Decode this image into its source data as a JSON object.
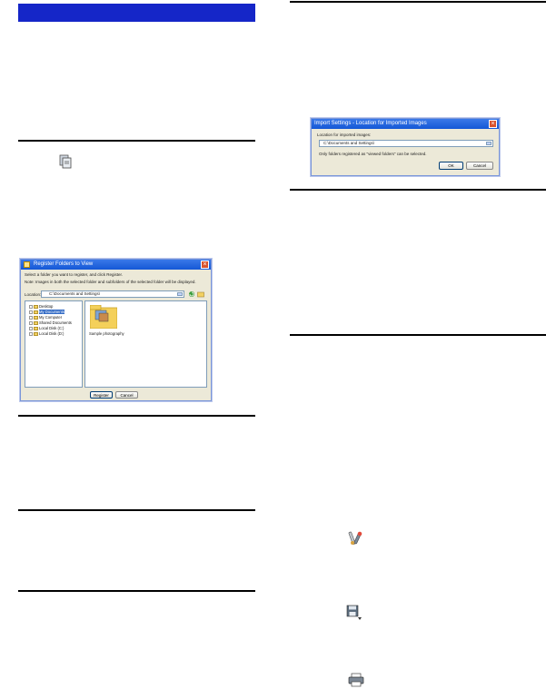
{
  "left_column": {
    "register_dialog": {
      "title": "Register Folders to View",
      "instruction": "Select a folder you want to register, and click Register.",
      "note": "Note: Images in both the selected folder and subfolders of the selected folder will be displayed.",
      "location_label": "Location:",
      "location_value": "C:\\Documents and Settings\\",
      "tree_items": [
        "Desktop",
        "My Documents",
        "My Computer",
        "Shared Documents",
        "Local Disk (C:)",
        "Local Disk (D:)"
      ],
      "tree_selected_index": 1,
      "folder_name": "Sample photography",
      "register_button": "Register",
      "cancel_button": "Cancel"
    }
  },
  "right_column": {
    "import_dialog": {
      "title": "Import Settings - Location for Imported Images",
      "location_label": "Location for imported images:",
      "location_value": "C:\\Documents and Settings\\",
      "note": "Only folders registered as \"viewed folders\" can be selected.",
      "ok_button": "OK",
      "cancel_button": "Cancel"
    }
  },
  "icons": {
    "register_icon": "register-folders-icon",
    "settings_icon": "tools-settings-icon",
    "save_icon": "save-disk-icon",
    "print_icon": "printer-icon"
  },
  "colors": {
    "header_blue": "#1526c8",
    "titlebar_blue": "#1457d6"
  }
}
